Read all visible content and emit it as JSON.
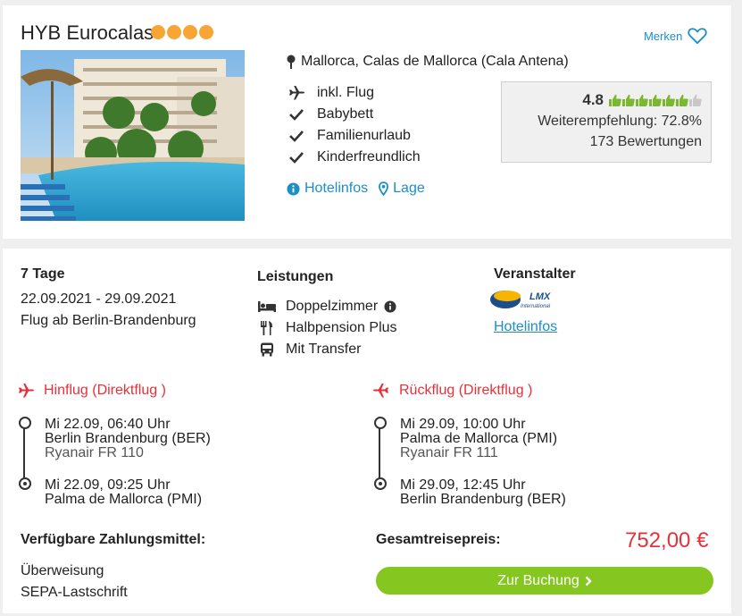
{
  "hotel": {
    "name": "HYB Eurocalas",
    "stars": 4,
    "star_color": "#f7a534",
    "merken_label": "Merken",
    "location": "Mallorca, Calas de Mallorca (Cala Antena)",
    "features": [
      {
        "icon": "plane-icon",
        "label": "inkl. Flug"
      },
      {
        "icon": "check-icon",
        "label": "Babybett"
      },
      {
        "icon": "check-icon",
        "label": "Familienurlaub"
      },
      {
        "icon": "check-icon",
        "label": "Kinderfreundlich"
      }
    ],
    "links": {
      "hotelinfos": "Hotelinfos",
      "lage": "Lage"
    },
    "rating": {
      "score": "4.8",
      "thumbs_filled": 6,
      "thumbs_total": 7,
      "recommendation": "Weiterempfehlung: 72.8%",
      "reviews": "173 Bewertungen"
    }
  },
  "offer": {
    "duration": "7 Tage",
    "dates": "22.09.2021 - 29.09.2021",
    "departure": "Flug ab Berlin-Brandenburg",
    "leistungen_title": "Leistungen",
    "leistungen": [
      {
        "icon": "bed-icon",
        "label": "Doppelzimmer"
      },
      {
        "icon": "cutlery-icon",
        "label": "Halbpension Plus"
      },
      {
        "icon": "bus-icon",
        "label": "Mit Transfer"
      }
    ],
    "veranstalter_title": "Veranstalter",
    "veranstalter_logo_text": "LMX International",
    "veranstalter_link": "Hotelinfos"
  },
  "outbound": {
    "title": "Hinflug (Direktflug )",
    "dep_time": "Mi 22.09, 06:40 Uhr",
    "dep_airport": "Berlin Brandenburg (BER)",
    "airline": "Ryanair FR 110",
    "arr_time": "Mi 22.09, 09:25 Uhr",
    "arr_airport": "Palma de Mallorca (PMI)"
  },
  "inbound": {
    "title": "Rückflug (Direktflug )",
    "dep_time": "Mi 29.09, 10:00 Uhr",
    "dep_airport": "Palma de Mallorca (PMI)",
    "airline": "Ryanair FR 111",
    "arr_time": "Mi 29.09, 12:45 Uhr",
    "arr_airport": "Berlin Brandenburg (BER)"
  },
  "payment": {
    "title": "Verfügbare Zahlungsmittel:",
    "methods": [
      "Überweisung",
      "SEPA-Lastschrift"
    ]
  },
  "total": {
    "label": "Gesamtreisepreis:",
    "price": "752,00 €",
    "button": "Zur Buchung"
  },
  "colors": {
    "accent_blue": "#1c8ec8",
    "price_red": "#e8303a",
    "button_green": "#86c620",
    "thumb_green": "#7cb82f"
  }
}
